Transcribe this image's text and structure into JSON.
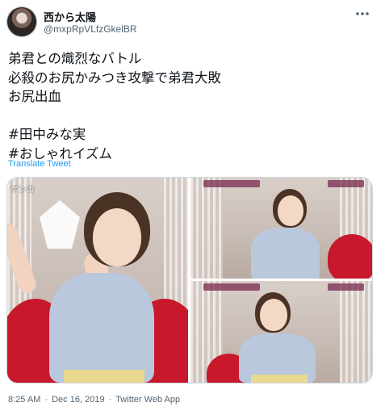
{
  "author": {
    "name": "西から太陽",
    "handle": "@mxpRpVLfzGkelBR"
  },
  "tweet": {
    "lines": [
      "弟君との熾烈なバトル",
      "必殺のお尻かみつき攻撃で弟君大敗",
      "お尻出血",
      "",
      "#田中みな実",
      "#おしゃれイズム"
    ],
    "translate_label": "Translate Tweet"
  },
  "media": {
    "photo1_caption": "ゲンカ"
  },
  "footer": {
    "time": "8:25 AM",
    "separator": "·",
    "date": "Dec 16, 2019",
    "source": "Twitter Web App"
  },
  "icons": {
    "more": "more-horizontal-icon"
  },
  "colors": {
    "link": "#1d9bf0",
    "secondary_text": "#536471",
    "border": "#cfd9de"
  }
}
